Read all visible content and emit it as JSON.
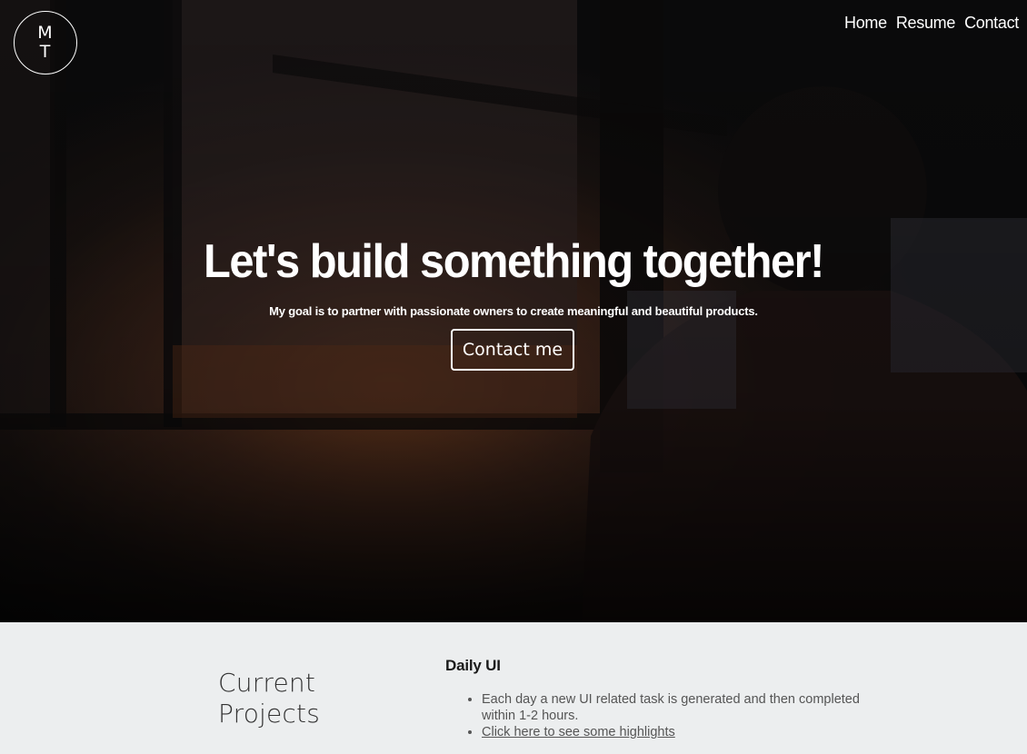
{
  "logo": {
    "line1": "M",
    "line2": "T"
  },
  "nav": {
    "home": "Home",
    "resume": "Resume",
    "contact": "Contact"
  },
  "hero": {
    "title": "Let's build something together!",
    "subtitle": "My goal is to partner with passionate owners to create meaningful and beautiful products.",
    "cta_label": "Contact me"
  },
  "projects": {
    "heading_line1": "Current",
    "heading_line2": "Projects",
    "items": [
      {
        "title": "Daily UI",
        "bullets": [
          "Each day a new UI related task is generated and then completed within 1-2 hours.",
          "Click here to see some highlights"
        ]
      }
    ]
  },
  "colors": {
    "hero_overlay": "#0c0b0c",
    "section_bg": "#eceeef",
    "text_dark": "#1a1a1a",
    "text_muted": "#555555",
    "white": "#ffffff"
  }
}
